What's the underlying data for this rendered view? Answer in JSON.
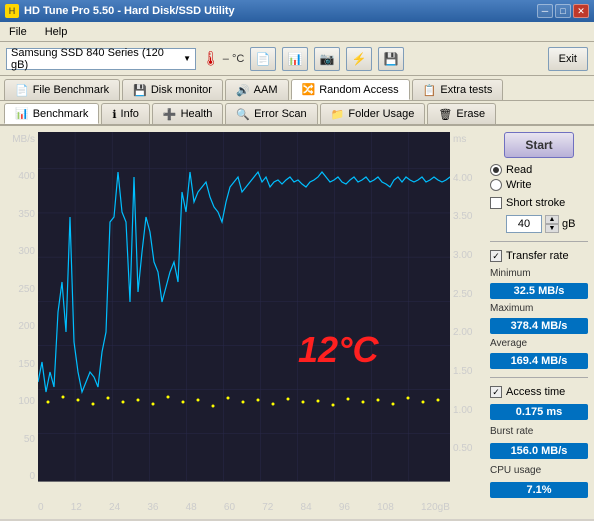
{
  "window": {
    "title": "HD Tune Pro 5.50 - Hard Disk/SSD Utility"
  },
  "menu": {
    "file": "File",
    "help": "Help"
  },
  "toolbar": {
    "drive": "Samsung SSD 840 Series (120 gB)",
    "temperature": "– °C",
    "exit_label": "Exit"
  },
  "tabs_row1": [
    {
      "id": "file-benchmark",
      "label": "File Benchmark",
      "icon": "📄"
    },
    {
      "id": "disk-monitor",
      "label": "Disk monitor",
      "icon": "💾"
    },
    {
      "id": "aam",
      "label": "AAM",
      "icon": "🔊"
    },
    {
      "id": "random-access",
      "label": "Random Access",
      "icon": "🔀"
    },
    {
      "id": "extra-tests",
      "label": "Extra tests",
      "icon": "📋"
    }
  ],
  "tabs_row2": [
    {
      "id": "benchmark",
      "label": "Benchmark",
      "icon": "📊"
    },
    {
      "id": "info",
      "label": "Info",
      "icon": "ℹ"
    },
    {
      "id": "health",
      "label": "Health",
      "icon": "➕"
    },
    {
      "id": "error-scan",
      "label": "Error Scan",
      "icon": "🔍"
    },
    {
      "id": "folder-usage",
      "label": "Folder Usage",
      "icon": "📁"
    },
    {
      "id": "erase",
      "label": "Erase",
      "icon": "🗑"
    }
  ],
  "chart": {
    "y_label_left": "MB/s",
    "y_label_right": "ms",
    "y_ticks_left": [
      400,
      350,
      300,
      250,
      200,
      150,
      100,
      50,
      0
    ],
    "y_ticks_right": [
      4.0,
      3.5,
      3.0,
      2.5,
      2.0,
      1.5,
      1.0,
      0.5,
      0
    ],
    "x_labels": [
      "0",
      "12",
      "24",
      "36",
      "48",
      "60",
      "72",
      "84",
      "96",
      "108",
      "120gB"
    ],
    "temperature": "12°C"
  },
  "controls": {
    "start_label": "Start",
    "read_label": "Read",
    "write_label": "Write",
    "short_stroke_label": "Short stroke",
    "gb_value": "40",
    "gb_unit": "gB",
    "transfer_rate_label": "Transfer rate",
    "access_time_label": "Access time"
  },
  "stats": {
    "minimum_label": "Minimum",
    "minimum_value": "32.5 MB/s",
    "maximum_label": "Maximum",
    "maximum_value": "378.4 MB/s",
    "average_label": "Average",
    "average_value": "169.4 MB/s",
    "access_time_label": "Access time",
    "access_time_value": "0.175 ms",
    "burst_rate_label": "Burst rate",
    "burst_rate_value": "156.0 MB/s",
    "cpu_usage_label": "CPU usage",
    "cpu_usage_value": "7.1%"
  }
}
